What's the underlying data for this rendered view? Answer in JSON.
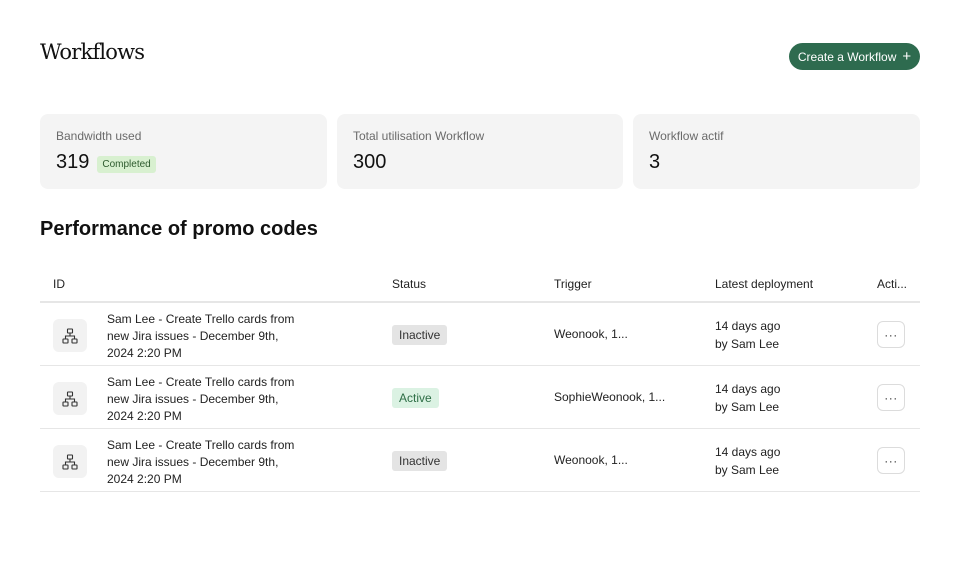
{
  "header": {
    "title": "Workflows",
    "create_button_label": "Create a Workflow",
    "create_button_icon": "plus-icon"
  },
  "stats": [
    {
      "label": "Bandwidth used",
      "value": "319",
      "badge": "Completed"
    },
    {
      "label": "Total utilisation Workflow",
      "value": "300"
    },
    {
      "label": "Workflow actif",
      "value": "3"
    }
  ],
  "section": {
    "title": "Performance of promo codes"
  },
  "table": {
    "columns": [
      "ID",
      "Status",
      "Trigger",
      "Latest deployment",
      "Acti..."
    ],
    "rows": [
      {
        "icon": "workflow-hierarchy-icon",
        "name": "Sam Lee - Create Trello cards from new Jira issues - December 9th, 2024 2:20 PM",
        "status": "Inactive",
        "trigger": "Weonook, 1...",
        "deploy_time": "14 days ago",
        "deploy_by": "by Sam Lee",
        "action": "···"
      },
      {
        "icon": "workflow-hierarchy-icon",
        "name": "Sam Lee - Create Trello cards from new Jira issues - December 9th, 2024 2:20 PM",
        "status": "Active",
        "trigger": "SophieWeonook, 1...",
        "deploy_time": "14 days ago",
        "deploy_by": "by Sam Lee",
        "action": "···"
      },
      {
        "icon": "workflow-hierarchy-icon",
        "name": "Sam Lee - Create Trello cards from new Jira issues - December 9th, 2024 2:20 PM",
        "status": "Inactive",
        "trigger": "Weonook, 1...",
        "deploy_time": "14 days ago",
        "deploy_by": "by Sam Lee",
        "action": "···"
      }
    ]
  },
  "colors": {
    "accent": "#2e6b4f",
    "card_bg": "#f4f4f4",
    "badge_completed_bg": "#d8f0d0",
    "status_active_bg": "#dbf2e3",
    "status_inactive_bg": "#e4e4e4"
  }
}
